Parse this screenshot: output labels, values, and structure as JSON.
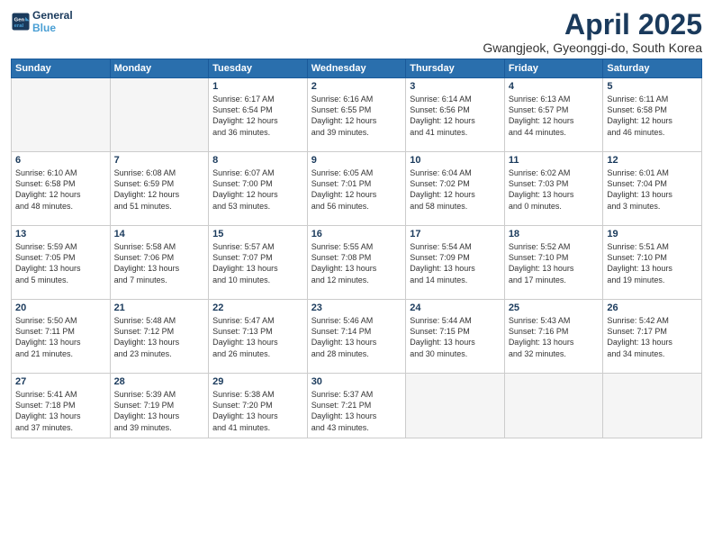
{
  "header": {
    "logo_line1": "General",
    "logo_line2": "Blue",
    "month_year": "April 2025",
    "location": "Gwangjeok, Gyeonggi-do, South Korea"
  },
  "weekdays": [
    "Sunday",
    "Monday",
    "Tuesday",
    "Wednesday",
    "Thursday",
    "Friday",
    "Saturday"
  ],
  "weeks": [
    [
      {
        "day": "",
        "detail": ""
      },
      {
        "day": "",
        "detail": ""
      },
      {
        "day": "1",
        "detail": "Sunrise: 6:17 AM\nSunset: 6:54 PM\nDaylight: 12 hours\nand 36 minutes."
      },
      {
        "day": "2",
        "detail": "Sunrise: 6:16 AM\nSunset: 6:55 PM\nDaylight: 12 hours\nand 39 minutes."
      },
      {
        "day": "3",
        "detail": "Sunrise: 6:14 AM\nSunset: 6:56 PM\nDaylight: 12 hours\nand 41 minutes."
      },
      {
        "day": "4",
        "detail": "Sunrise: 6:13 AM\nSunset: 6:57 PM\nDaylight: 12 hours\nand 44 minutes."
      },
      {
        "day": "5",
        "detail": "Sunrise: 6:11 AM\nSunset: 6:58 PM\nDaylight: 12 hours\nand 46 minutes."
      }
    ],
    [
      {
        "day": "6",
        "detail": "Sunrise: 6:10 AM\nSunset: 6:58 PM\nDaylight: 12 hours\nand 48 minutes."
      },
      {
        "day": "7",
        "detail": "Sunrise: 6:08 AM\nSunset: 6:59 PM\nDaylight: 12 hours\nand 51 minutes."
      },
      {
        "day": "8",
        "detail": "Sunrise: 6:07 AM\nSunset: 7:00 PM\nDaylight: 12 hours\nand 53 minutes."
      },
      {
        "day": "9",
        "detail": "Sunrise: 6:05 AM\nSunset: 7:01 PM\nDaylight: 12 hours\nand 56 minutes."
      },
      {
        "day": "10",
        "detail": "Sunrise: 6:04 AM\nSunset: 7:02 PM\nDaylight: 12 hours\nand 58 minutes."
      },
      {
        "day": "11",
        "detail": "Sunrise: 6:02 AM\nSunset: 7:03 PM\nDaylight: 13 hours\nand 0 minutes."
      },
      {
        "day": "12",
        "detail": "Sunrise: 6:01 AM\nSunset: 7:04 PM\nDaylight: 13 hours\nand 3 minutes."
      }
    ],
    [
      {
        "day": "13",
        "detail": "Sunrise: 5:59 AM\nSunset: 7:05 PM\nDaylight: 13 hours\nand 5 minutes."
      },
      {
        "day": "14",
        "detail": "Sunrise: 5:58 AM\nSunset: 7:06 PM\nDaylight: 13 hours\nand 7 minutes."
      },
      {
        "day": "15",
        "detail": "Sunrise: 5:57 AM\nSunset: 7:07 PM\nDaylight: 13 hours\nand 10 minutes."
      },
      {
        "day": "16",
        "detail": "Sunrise: 5:55 AM\nSunset: 7:08 PM\nDaylight: 13 hours\nand 12 minutes."
      },
      {
        "day": "17",
        "detail": "Sunrise: 5:54 AM\nSunset: 7:09 PM\nDaylight: 13 hours\nand 14 minutes."
      },
      {
        "day": "18",
        "detail": "Sunrise: 5:52 AM\nSunset: 7:10 PM\nDaylight: 13 hours\nand 17 minutes."
      },
      {
        "day": "19",
        "detail": "Sunrise: 5:51 AM\nSunset: 7:10 PM\nDaylight: 13 hours\nand 19 minutes."
      }
    ],
    [
      {
        "day": "20",
        "detail": "Sunrise: 5:50 AM\nSunset: 7:11 PM\nDaylight: 13 hours\nand 21 minutes."
      },
      {
        "day": "21",
        "detail": "Sunrise: 5:48 AM\nSunset: 7:12 PM\nDaylight: 13 hours\nand 23 minutes."
      },
      {
        "day": "22",
        "detail": "Sunrise: 5:47 AM\nSunset: 7:13 PM\nDaylight: 13 hours\nand 26 minutes."
      },
      {
        "day": "23",
        "detail": "Sunrise: 5:46 AM\nSunset: 7:14 PM\nDaylight: 13 hours\nand 28 minutes."
      },
      {
        "day": "24",
        "detail": "Sunrise: 5:44 AM\nSunset: 7:15 PM\nDaylight: 13 hours\nand 30 minutes."
      },
      {
        "day": "25",
        "detail": "Sunrise: 5:43 AM\nSunset: 7:16 PM\nDaylight: 13 hours\nand 32 minutes."
      },
      {
        "day": "26",
        "detail": "Sunrise: 5:42 AM\nSunset: 7:17 PM\nDaylight: 13 hours\nand 34 minutes."
      }
    ],
    [
      {
        "day": "27",
        "detail": "Sunrise: 5:41 AM\nSunset: 7:18 PM\nDaylight: 13 hours\nand 37 minutes."
      },
      {
        "day": "28",
        "detail": "Sunrise: 5:39 AM\nSunset: 7:19 PM\nDaylight: 13 hours\nand 39 minutes."
      },
      {
        "day": "29",
        "detail": "Sunrise: 5:38 AM\nSunset: 7:20 PM\nDaylight: 13 hours\nand 41 minutes."
      },
      {
        "day": "30",
        "detail": "Sunrise: 5:37 AM\nSunset: 7:21 PM\nDaylight: 13 hours\nand 43 minutes."
      },
      {
        "day": "",
        "detail": ""
      },
      {
        "day": "",
        "detail": ""
      },
      {
        "day": "",
        "detail": ""
      }
    ]
  ]
}
